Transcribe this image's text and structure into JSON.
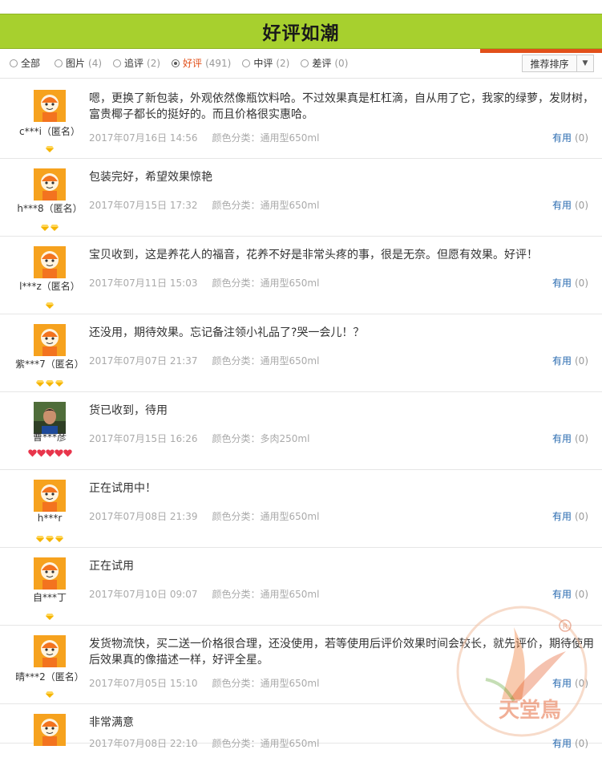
{
  "banner": {
    "title": "好评如潮"
  },
  "filters": [
    {
      "label": "全部",
      "count": "",
      "checked": false
    },
    {
      "label": "图片",
      "count": "(4)",
      "checked": false
    },
    {
      "label": "追评",
      "count": "(2)",
      "checked": false
    },
    {
      "label": "好评",
      "count": "(491)",
      "checked": true
    },
    {
      "label": "中评",
      "count": "(2)",
      "checked": false
    },
    {
      "label": "差评",
      "count": "(0)",
      "checked": false
    }
  ],
  "sort": {
    "label": "推荐排序"
  },
  "useful_label": "有用",
  "reviews": [
    {
      "user": "c***i（匿名）",
      "text": "嗯，更换了新包装，外观依然像瓶饮料哈。不过效果真是杠杠滴，自从用了它，我家的绿萝，发财树，富贵椰子都长的挺好的。而且价格很实惠哈。",
      "date": "2017年07月16日 14:56",
      "sku": "颜色分类：通用型650ml",
      "useful": "(0)",
      "badge": {
        "kind": "diamond",
        "count": 1
      }
    },
    {
      "user": "h***8（匿名）",
      "text": "包装完好，希望效果惊艳",
      "date": "2017年07月15日 17:32",
      "sku": "颜色分类：通用型650ml",
      "useful": "(0)",
      "badge": {
        "kind": "diamond",
        "count": 2
      }
    },
    {
      "user": "l***z（匿名）",
      "text": "宝贝收到，这是养花人的福音，花养不好是非常头疼的事，很是无奈。但愿有效果。好评！",
      "date": "2017年07月11日 15:03",
      "sku": "颜色分类：通用型650ml",
      "useful": "(0)",
      "badge": {
        "kind": "diamond",
        "count": 1
      }
    },
    {
      "user": "紫***7（匿名）",
      "text": "还没用，期待效果。忘记备注领小礼品了?哭一会儿！？",
      "date": "2017年07月07日 21:37",
      "sku": "颜色分类：通用型650ml",
      "useful": "(0)",
      "badge": {
        "kind": "diamond",
        "count": 3
      }
    },
    {
      "user": "曹***彦",
      "text": "货已收到，待用",
      "date": "2017年07月15日 16:26",
      "sku": "颜色分类：多肉250ml",
      "useful": "(0)",
      "badge": {
        "kind": "heart",
        "count": 5
      },
      "photo": true
    },
    {
      "user": "h***r",
      "text": "正在试用中！",
      "date": "2017年07月08日 21:39",
      "sku": "颜色分类：通用型650ml",
      "useful": "(0)",
      "badge": {
        "kind": "diamond",
        "count": 3
      }
    },
    {
      "user": "自***丁",
      "text": "正在试用",
      "date": "2017年07月10日 09:07",
      "sku": "颜色分类：通用型650ml",
      "useful": "(0)",
      "badge": {
        "kind": "diamond",
        "count": 1
      }
    },
    {
      "user": "晴***2（匿名）",
      "text": "发货物流快，买二送一价格很合理，还没使用，若等使用后评价效果时间会较长，就先评价，期待使用后效果真的像描述一样，好评全星。",
      "date": "2017年07月05日 15:10",
      "sku": "颜色分类：通用型650ml",
      "useful": "(0)",
      "badge": {
        "kind": "diamond",
        "count": 1
      }
    },
    {
      "user": "",
      "text": "非常满意",
      "date": "2017年07月08日 22:10",
      "sku": "颜色分类：通用型650ml",
      "useful": "(0)",
      "badge": {
        "kind": "diamond",
        "count": 0
      }
    }
  ],
  "watermark": {
    "text": "天堂鳥"
  },
  "colors": {
    "banner": "#a7d02e",
    "accent": "#e2501a",
    "link": "#2a6bb0",
    "diamond": "#f5b400",
    "heart": "#e8354b"
  }
}
